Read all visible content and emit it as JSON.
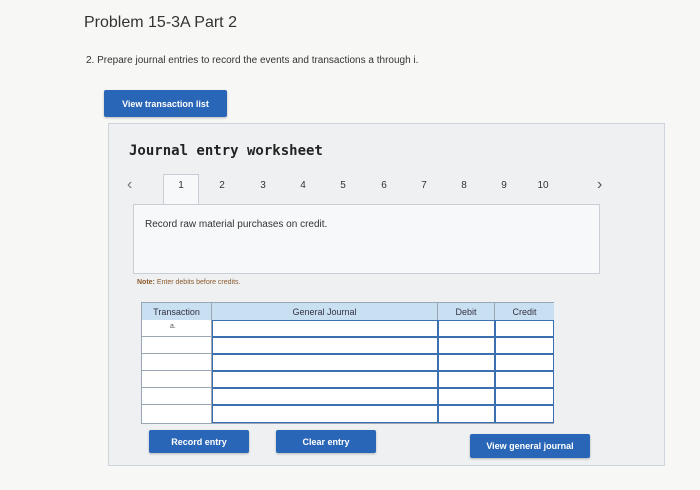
{
  "problem": {
    "title": "Problem 15-3A Part 2",
    "instruction": "2. Prepare journal entries to record the events and transactions a through i."
  },
  "buttons": {
    "view_transaction_list": "View transaction list",
    "record_entry": "Record entry",
    "clear_entry": "Clear entry",
    "view_general_journal": "View general journal"
  },
  "worksheet": {
    "title": "Journal entry worksheet",
    "pages": [
      "1",
      "2",
      "3",
      "4",
      "5",
      "6",
      "7",
      "8",
      "9",
      "10"
    ],
    "active_page": "1",
    "record_instruction": "Record raw material purchases on credit.",
    "note_label": "Note:",
    "note_text": "Enter debits before credits."
  },
  "journal": {
    "headers": {
      "transaction": "Transaction",
      "general_journal": "General Journal",
      "debit": "Debit",
      "credit": "Credit"
    },
    "first_transaction": "a."
  },
  "colors": {
    "button_blue": "#2a66b7",
    "header_blue": "#c9dff2",
    "note_brown": "#8b5a2b"
  },
  "icons": {
    "prev": "chevron-left-icon",
    "next": "chevron-right-icon"
  }
}
